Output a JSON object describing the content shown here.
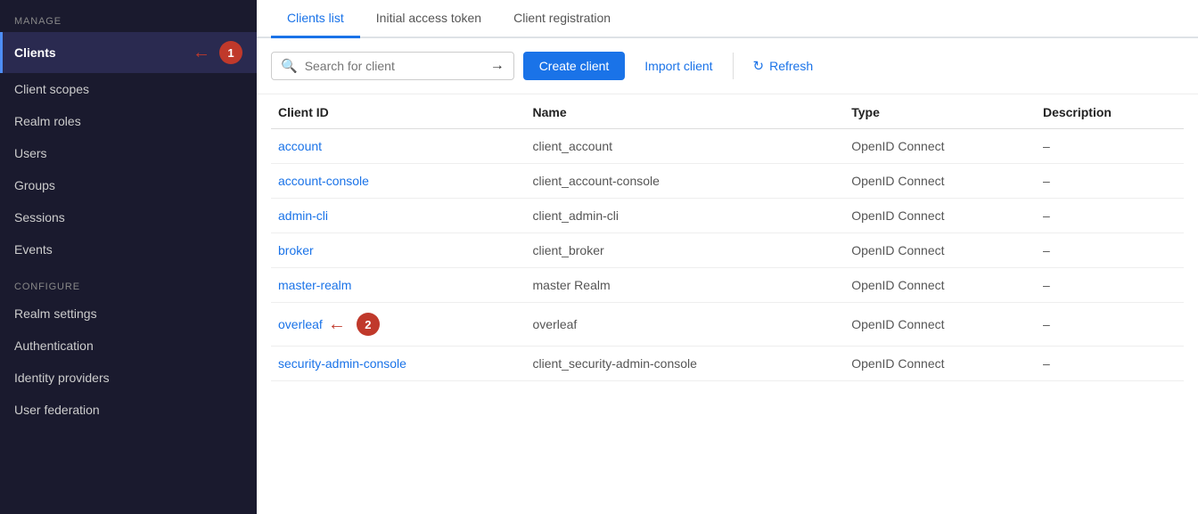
{
  "sidebar": {
    "manage_label": "Manage",
    "configure_label": "Configure",
    "items_manage": [
      {
        "id": "clients",
        "label": "Clients",
        "active": true
      },
      {
        "id": "client-scopes",
        "label": "Client scopes",
        "active": false
      },
      {
        "id": "realm-roles",
        "label": "Realm roles",
        "active": false
      },
      {
        "id": "users",
        "label": "Users",
        "active": false
      },
      {
        "id": "groups",
        "label": "Groups",
        "active": false
      },
      {
        "id": "sessions",
        "label": "Sessions",
        "active": false
      },
      {
        "id": "events",
        "label": "Events",
        "active": false
      }
    ],
    "items_configure": [
      {
        "id": "realm-settings",
        "label": "Realm settings",
        "active": false
      },
      {
        "id": "authentication",
        "label": "Authentication",
        "active": false
      },
      {
        "id": "identity-providers",
        "label": "Identity providers",
        "active": false
      },
      {
        "id": "user-federation",
        "label": "User federation",
        "active": false
      }
    ]
  },
  "tabs": [
    {
      "id": "clients-list",
      "label": "Clients list",
      "active": true
    },
    {
      "id": "initial-access-token",
      "label": "Initial access token",
      "active": false
    },
    {
      "id": "client-registration",
      "label": "Client registration",
      "active": false
    }
  ],
  "toolbar": {
    "search_placeholder": "Search for client",
    "create_client_label": "Create client",
    "import_client_label": "Import client",
    "refresh_label": "Refresh"
  },
  "table": {
    "columns": [
      {
        "id": "client-id",
        "label": "Client ID"
      },
      {
        "id": "name",
        "label": "Name"
      },
      {
        "id": "type",
        "label": "Type"
      },
      {
        "id": "description",
        "label": "Description"
      }
    ],
    "rows": [
      {
        "client_id": "account",
        "name": "client_account",
        "type": "OpenID Connect",
        "description": "–",
        "annotated": false
      },
      {
        "client_id": "account-console",
        "name": "client_account-console",
        "type": "OpenID Connect",
        "description": "–",
        "annotated": false
      },
      {
        "client_id": "admin-cli",
        "name": "client_admin-cli",
        "type": "OpenID Connect",
        "description": "–",
        "annotated": false
      },
      {
        "client_id": "broker",
        "name": "client_broker",
        "type": "OpenID Connect",
        "description": "–",
        "annotated": false
      },
      {
        "client_id": "master-realm",
        "name": "master Realm",
        "type": "OpenID Connect",
        "description": "–",
        "annotated": false
      },
      {
        "client_id": "overleaf",
        "name": "overleaf",
        "type": "OpenID Connect",
        "description": "–",
        "annotated": true
      },
      {
        "client_id": "security-admin-console",
        "name": "client_security-admin-console",
        "type": "OpenID Connect",
        "description": "–",
        "annotated": false
      }
    ]
  },
  "annotations": {
    "badge1": "1",
    "badge2": "2"
  }
}
